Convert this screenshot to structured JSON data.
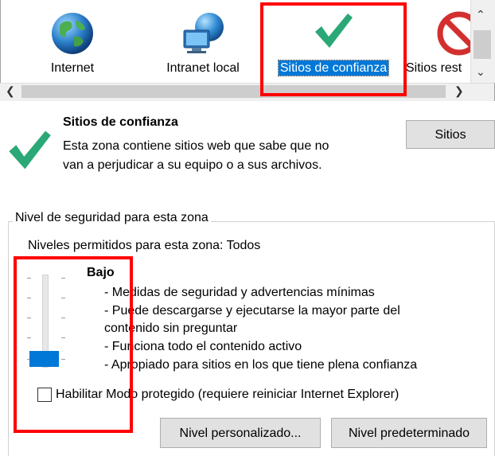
{
  "zones": [
    {
      "label": "Internet",
      "icon": "globe-icon"
    },
    {
      "label": "Intranet local",
      "icon": "intranet-icon"
    },
    {
      "label": "Sitios de confianza",
      "icon": "checkmark-icon",
      "selected": true
    },
    {
      "label": "Sitios rest",
      "icon": "restricted-icon"
    }
  ],
  "zone_info": {
    "title": "Sitios de confianza",
    "description_line1": "Esta zona contiene sitios web que sabe que no",
    "description_line2": "van a perjudicar a su equipo o a sus archivos.",
    "sites_button": "Sitios"
  },
  "security": {
    "group_title": "Nivel de seguridad para esta zona",
    "allowed_levels": "Niveles permitidos para esta zona: Todos",
    "level_name": "Bajo",
    "desc": [
      "- Medidas de seguridad y advertencias mínimas",
      "- Puede descargarse y ejecutarse la mayor parte del",
      "contenido sin preguntar",
      "- Funciona todo el contenido activo",
      "- Apropiado para sitios en los que tiene plena confianza"
    ],
    "protected_mode_label": "Habilitar Modo protegido (requiere reiniciar Internet Explorer)",
    "protected_mode_checked": false,
    "custom_level_button": "Nivel personalizado...",
    "default_level_button": "Nivel predeterminado",
    "slider_level_fraction": 0
  },
  "colors": {
    "selection": "#0078d7",
    "highlight_box": "#ff0000",
    "check_green": "#2aa876"
  }
}
